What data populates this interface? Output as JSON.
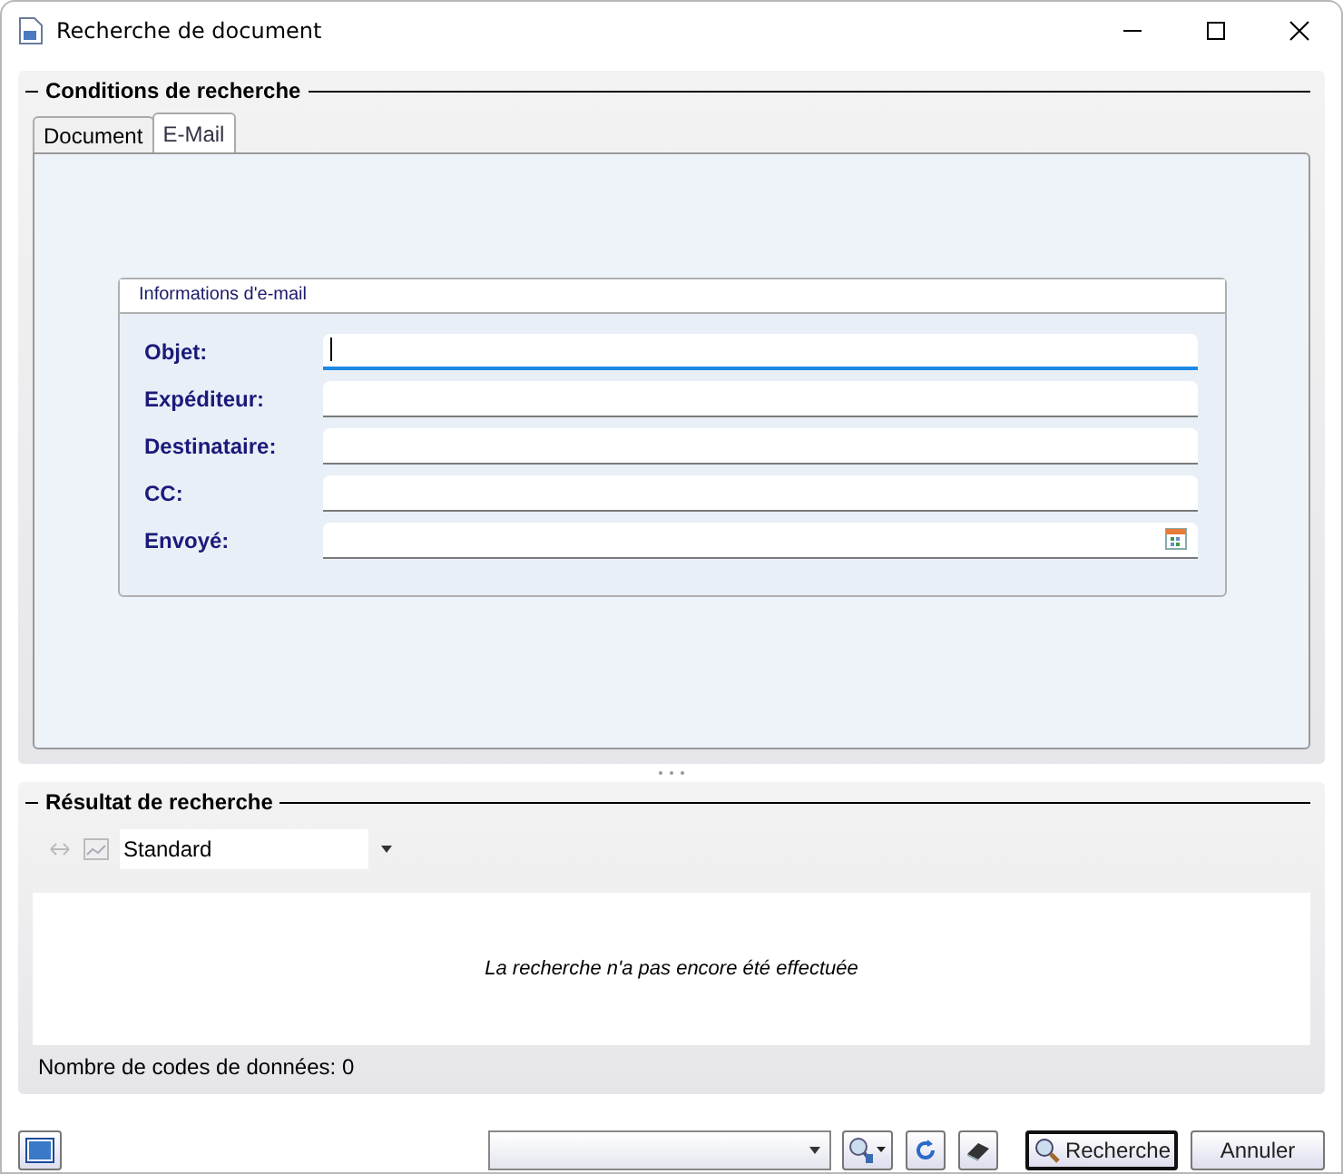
{
  "window": {
    "title": "Recherche de document"
  },
  "conditions": {
    "title": "Conditions de recherche",
    "tabs": [
      {
        "label": "Document",
        "selected": false
      },
      {
        "label": "E-Mail",
        "selected": true
      }
    ],
    "group": {
      "title": "Informations d'e-mail",
      "fields": [
        {
          "label": "Objet:",
          "kind": "text",
          "focused": true
        },
        {
          "label": "Expéditeur:",
          "kind": "text",
          "focused": false
        },
        {
          "label": "Destinataire:",
          "kind": "text",
          "focused": false
        },
        {
          "label": "CC:",
          "kind": "text",
          "focused": false
        },
        {
          "label": "Envoyé:",
          "kind": "date",
          "focused": false
        }
      ]
    }
  },
  "results": {
    "title": "Résultat de recherche",
    "view": {
      "value": "Standard"
    },
    "empty_message": "La recherche n'a pas encore été effectuée",
    "count_text": "Nombre de codes de données: 0"
  },
  "footer": {
    "search_button": {
      "label": "Recherche",
      "default": true
    },
    "cancel_button": {
      "label": "Annuler"
    }
  }
}
